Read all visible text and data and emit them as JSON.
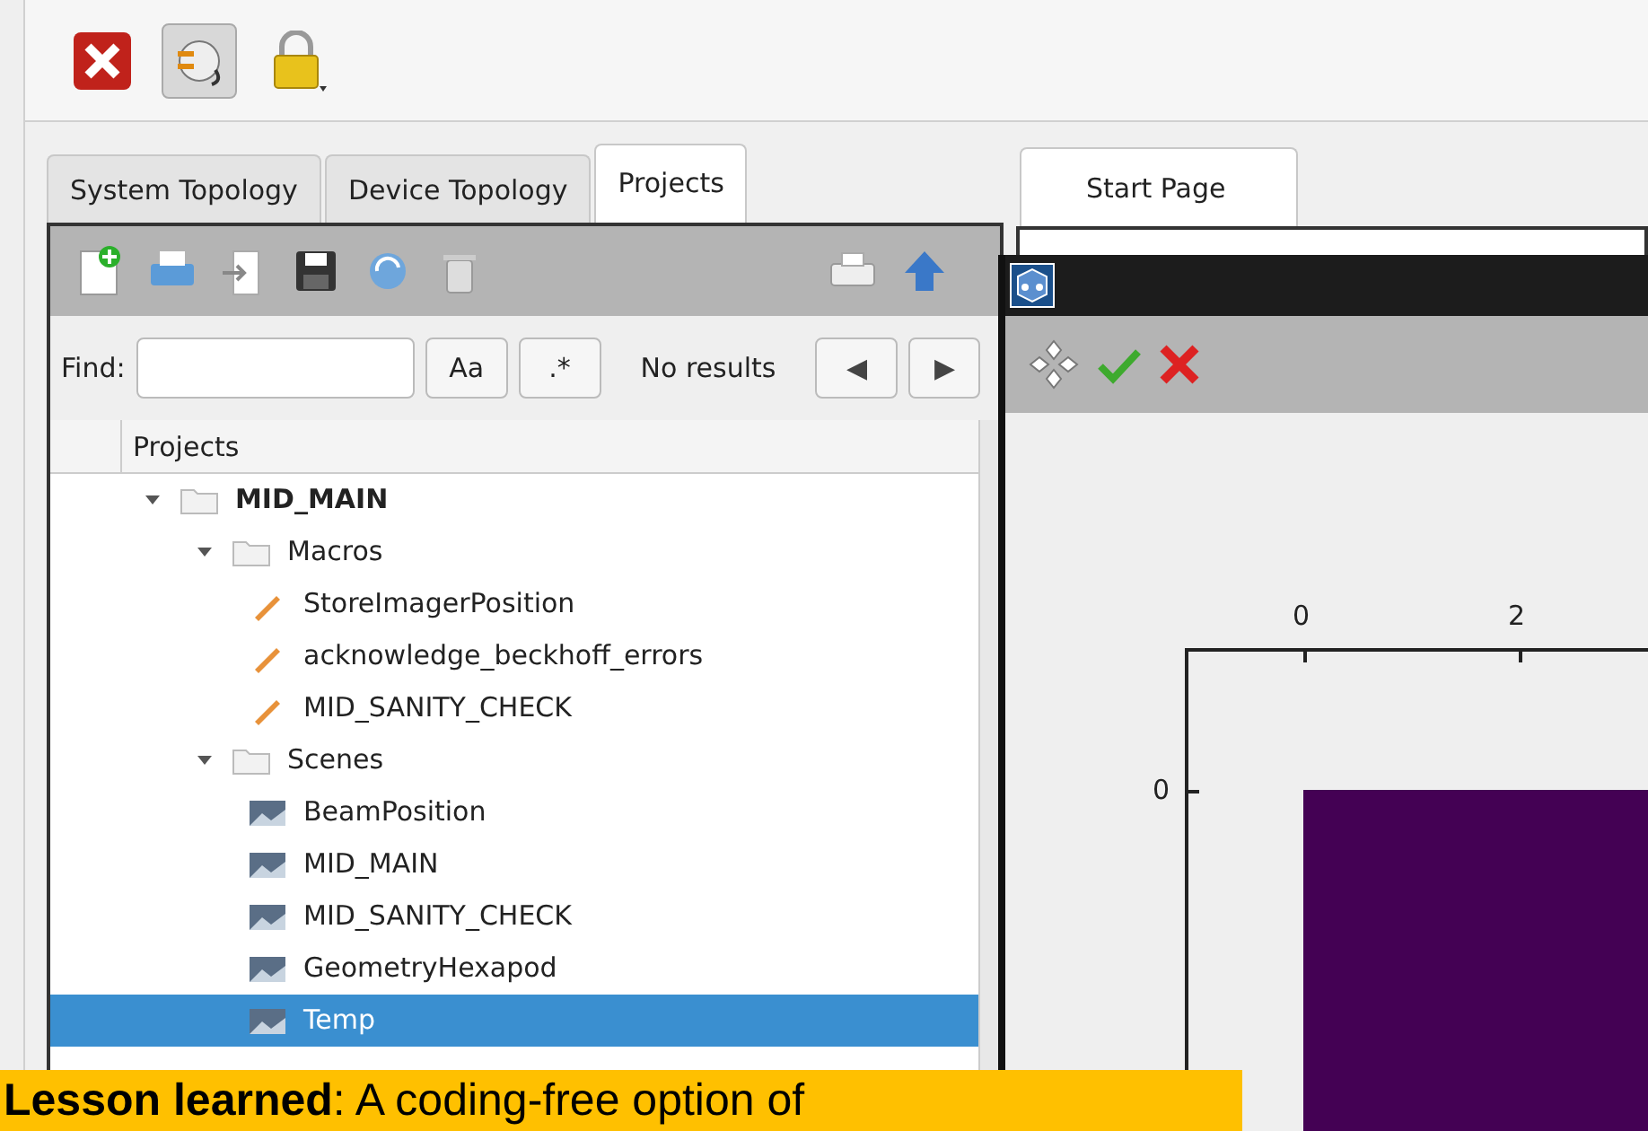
{
  "top_toolbar": {
    "buttons": [
      {
        "kind": "close",
        "pressed": false
      },
      {
        "kind": "connect",
        "pressed": true
      },
      {
        "kind": "lock",
        "pressed": false
      }
    ]
  },
  "left_tabs": [
    {
      "label": "System Topology",
      "selected": false
    },
    {
      "label": "Device Topology",
      "selected": false
    },
    {
      "label": "Projects",
      "selected": true
    }
  ],
  "find_bar": {
    "label": "Find:",
    "case_button": "Aa",
    "regex_button": ".*",
    "status": "No results",
    "prev_button": "◀",
    "next_button": "▶"
  },
  "tree": {
    "header": "Projects",
    "items": [
      {
        "label": "MID_MAIN",
        "kind": "folder",
        "expanded": true,
        "selected": false,
        "children": [
          {
            "label": "Macros",
            "kind": "folder",
            "expanded": true,
            "selected": false,
            "children": [
              {
                "label": "StoreImagerPosition",
                "kind": "macro",
                "selected": false
              },
              {
                "label": "acknowledge_beckhoff_errors",
                "kind": "macro",
                "selected": false
              },
              {
                "label": "MID_SANITY_CHECK",
                "kind": "macro",
                "selected": false
              }
            ]
          },
          {
            "label": "Scenes",
            "kind": "folder",
            "expanded": true,
            "selected": false,
            "children": [
              {
                "label": "BeamPosition",
                "kind": "scene",
                "selected": false
              },
              {
                "label": "MID_MAIN",
                "kind": "scene",
                "selected": false
              },
              {
                "label": "MID_SANITY_CHECK",
                "kind": "scene",
                "selected": false
              },
              {
                "label": "GeometryHexapod",
                "kind": "scene",
                "selected": false
              },
              {
                "label": "Temp",
                "kind": "scene",
                "selected": true
              }
            ]
          }
        ]
      }
    ]
  },
  "right_tabs": [
    {
      "label": "Start Page",
      "selected": true
    }
  ],
  "plot": {
    "x_ticks": [
      "0",
      "2"
    ],
    "y_ticks": [
      "0"
    ]
  },
  "caption": "**Lesson learned**: A coding-free option of"
}
